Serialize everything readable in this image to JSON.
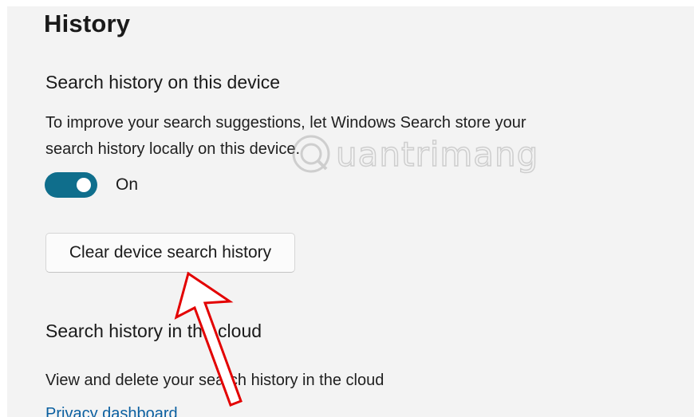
{
  "page": {
    "heading": "History"
  },
  "device_section": {
    "title": "Search history on this device",
    "description_line1": "To improve your search suggestions, let Windows Search store your",
    "description_line2": "search history locally on this device.",
    "toggle": {
      "state": "on",
      "label": "On",
      "color": "#0f6e8c"
    },
    "clear_button_label": "Clear device search history"
  },
  "cloud_section": {
    "title": "Search history in the cloud",
    "description": "View and delete your search history in the cloud",
    "link_label": "Privacy dashboard",
    "link_color": "#0a5fa0"
  },
  "watermark": {
    "text": "uantrimang",
    "icon": "quantrimang-logo-icon"
  },
  "annotation": {
    "icon": "red-arrow-icon",
    "color": "#e30000"
  }
}
